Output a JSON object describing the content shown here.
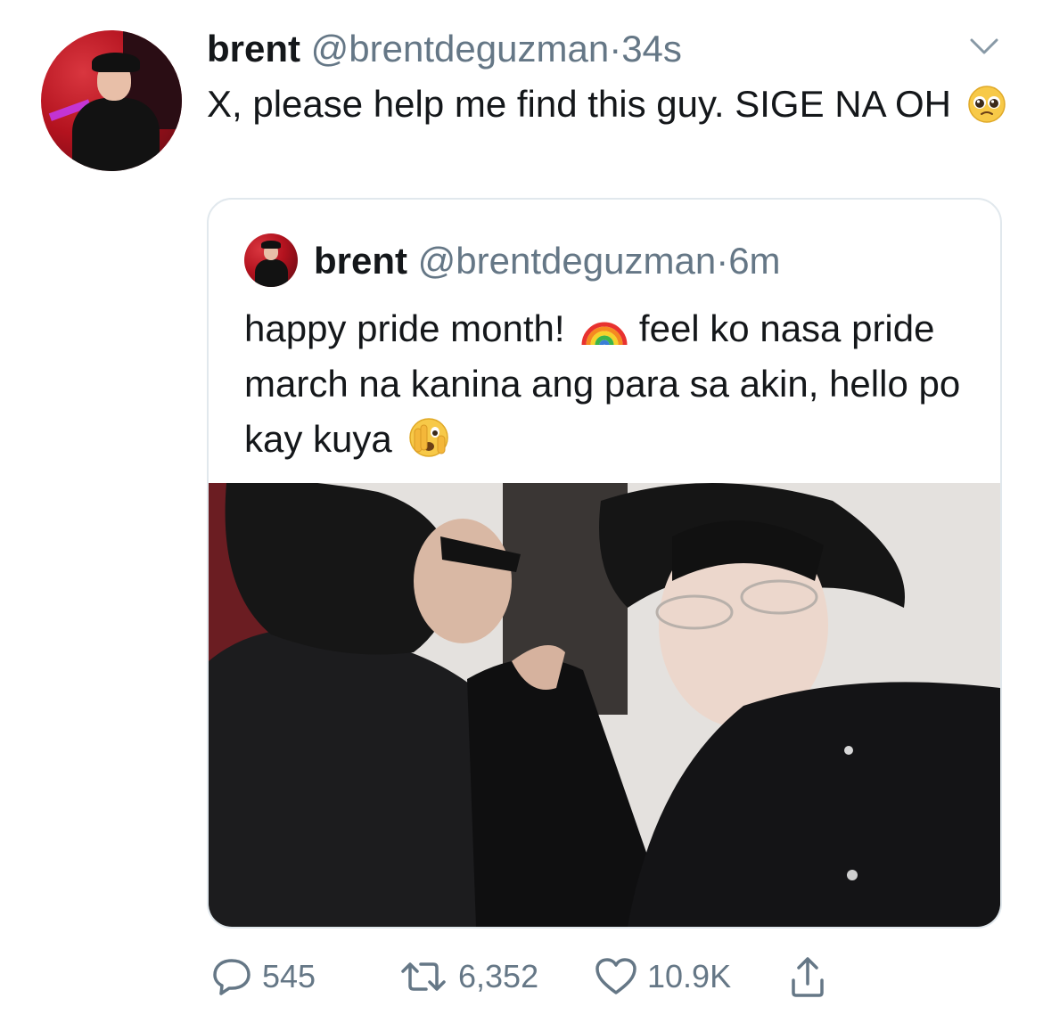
{
  "tweet": {
    "display_name": "brent",
    "handle": "@brentdeguzman",
    "separator": "·",
    "time": "34s",
    "text": "X, please help me find this guy. SIGE NA OH",
    "text_emoji": "pleading-face-emoji"
  },
  "quoted_tweet": {
    "display_name": "brent",
    "handle": "@brentdeguzman",
    "separator": "·",
    "time": "6m",
    "text_part1": "happy pride month!",
    "emoji1": "rainbow-emoji",
    "text_part2": "feel ko nasa pride march na kanina ang para sa akin, hello po kay kuya",
    "emoji2": "face-with-peeking-eye-emoji"
  },
  "actions": {
    "reply_count": "545",
    "retweet_count": "6,352",
    "like_count": "10.9K"
  },
  "colors": {
    "text": "#14171a",
    "secondary": "#657786",
    "border": "#e1e8ed"
  }
}
